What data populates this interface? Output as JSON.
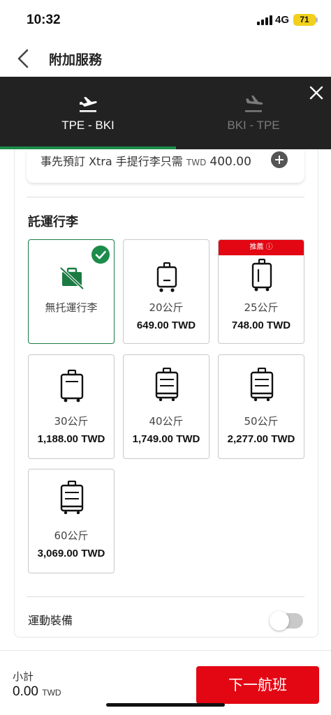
{
  "status_bar": {
    "time": "10:32",
    "network": "4G",
    "battery": "71"
  },
  "header": {
    "title": "附加服務",
    "back_icon": "chevron-left-icon"
  },
  "flight_tabs": [
    {
      "label": "TPE - BKI",
      "icon": "plane-departure-icon",
      "active": true
    },
    {
      "label": "BKI - TPE",
      "icon": "plane-arrival-icon",
      "active": false
    }
  ],
  "close_icon": "close-icon",
  "xtra": {
    "text": "事先預訂 Xtra 手提行李只需",
    "currency": "TWD",
    "price": "400.00",
    "add_icon": "plus-circle-icon"
  },
  "checked_baggage": {
    "title": "託運行李",
    "options": [
      {
        "weight": "無托運行李",
        "price": "",
        "icon": "no-luggage-icon",
        "selected": true
      },
      {
        "weight": "20公斤",
        "price": "649.00 TWD",
        "icon": "luggage-icon",
        "selected": false
      },
      {
        "weight": "25公斤",
        "price": "748.00 TWD",
        "icon": "luggage-icon",
        "selected": false,
        "badge": "推薦 ⓘ"
      },
      {
        "weight": "30公斤",
        "price": "1,188.00 TWD",
        "icon": "luggage-icon",
        "selected": false
      },
      {
        "weight": "40公斤",
        "price": "1,749.00 TWD",
        "icon": "luggage-icon",
        "selected": false
      },
      {
        "weight": "50公斤",
        "price": "2,277.00 TWD",
        "icon": "luggage-icon",
        "selected": false
      },
      {
        "weight": "60公斤",
        "price": "3,069.00 TWD",
        "icon": "luggage-icon",
        "selected": false
      }
    ]
  },
  "sports": {
    "label": "運動裝備",
    "enabled": false
  },
  "footer": {
    "subtotal_label": "小計",
    "subtotal_value": "0.00",
    "subtotal_currency": "TWD",
    "next_label": "下一航班"
  },
  "colors": {
    "brand_red": "#e30613",
    "brand_green": "#1c8c4a",
    "tab_bg": "#222222"
  }
}
